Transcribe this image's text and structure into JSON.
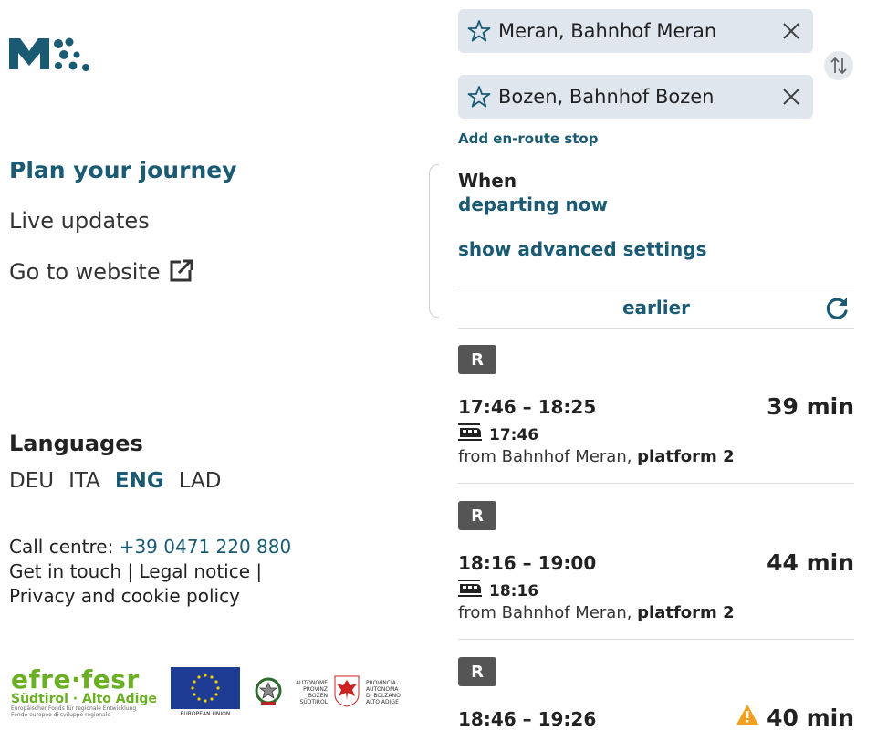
{
  "nav": {
    "plan": "Plan your journey",
    "live": "Live updates",
    "website": "Go to website"
  },
  "languages": {
    "title": "Languages",
    "items": [
      "DEU",
      "ITA",
      "ENG",
      "LAD"
    ],
    "active": "ENG"
  },
  "footer": {
    "call_label": "Call centre: ",
    "phone": "+39 0471 220 880",
    "line2": "Get in touch | Legal notice |",
    "line3": "Privacy and cookie policy"
  },
  "logos": {
    "efre_big": "efre·fesr",
    "efre_sub": "Südtirol · Alto Adige",
    "efre_tiny1": "Europäischer Fonds für regionale Entwicklung",
    "efre_tiny2": "Fondo europeo di sviluppo regionale",
    "eu_label": "EUROPEAN UNION",
    "prov_de": [
      "AUTONOME",
      "PROVINZ",
      "BOZEN",
      "SÜDTIROL"
    ],
    "prov_it": [
      "PROVINCIA",
      "AUTONOMA",
      "DI BOLZANO",
      "ALTO ADIGE"
    ]
  },
  "search": {
    "from": "Meran, Bahnhof Meran",
    "to": "Bozen, Bahnhof Bozen",
    "add_stop": "Add en-route stop",
    "when_label": "When",
    "when_value": "departing now",
    "advanced": "show advanced settings",
    "earlier": "earlier"
  },
  "trips": [
    {
      "badge": "R",
      "times": "17:46 – 18:25",
      "duration": "39 min",
      "dep": "17:46",
      "from": "from Bahnhof Meran, ",
      "platform": "platform 2",
      "warning": false
    },
    {
      "badge": "R",
      "times": "18:16 – 19:00",
      "duration": "44 min",
      "dep": "18:16",
      "from": "from Bahnhof Meran, ",
      "platform": "platform 2",
      "warning": false
    },
    {
      "badge": "R",
      "times": "18:46 – 19:26",
      "duration": "40 min",
      "warning": true
    }
  ],
  "colors": {
    "accent": "#1b5a73",
    "field_bg": "#dfe6ee",
    "badge": "#555555",
    "warning": "#f0a020"
  }
}
